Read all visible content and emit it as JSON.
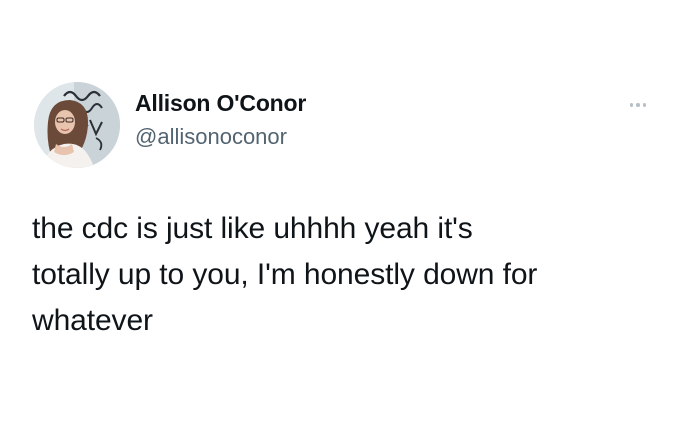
{
  "tweet": {
    "author": {
      "display_name": "Allison O'Conor",
      "handle": "@allisonoconor",
      "avatar_icon": "profile-photo"
    },
    "more_icon": "more-horizontal-icon",
    "text": "the cdc is just like uhhhh yeah it's\ntotally up to you, I'm honestly down for\nwhatever"
  },
  "colors": {
    "background": "#ffffff",
    "name_text": "#0f1419",
    "handle_text": "#536471",
    "more_dots": "#b7c0c8"
  }
}
